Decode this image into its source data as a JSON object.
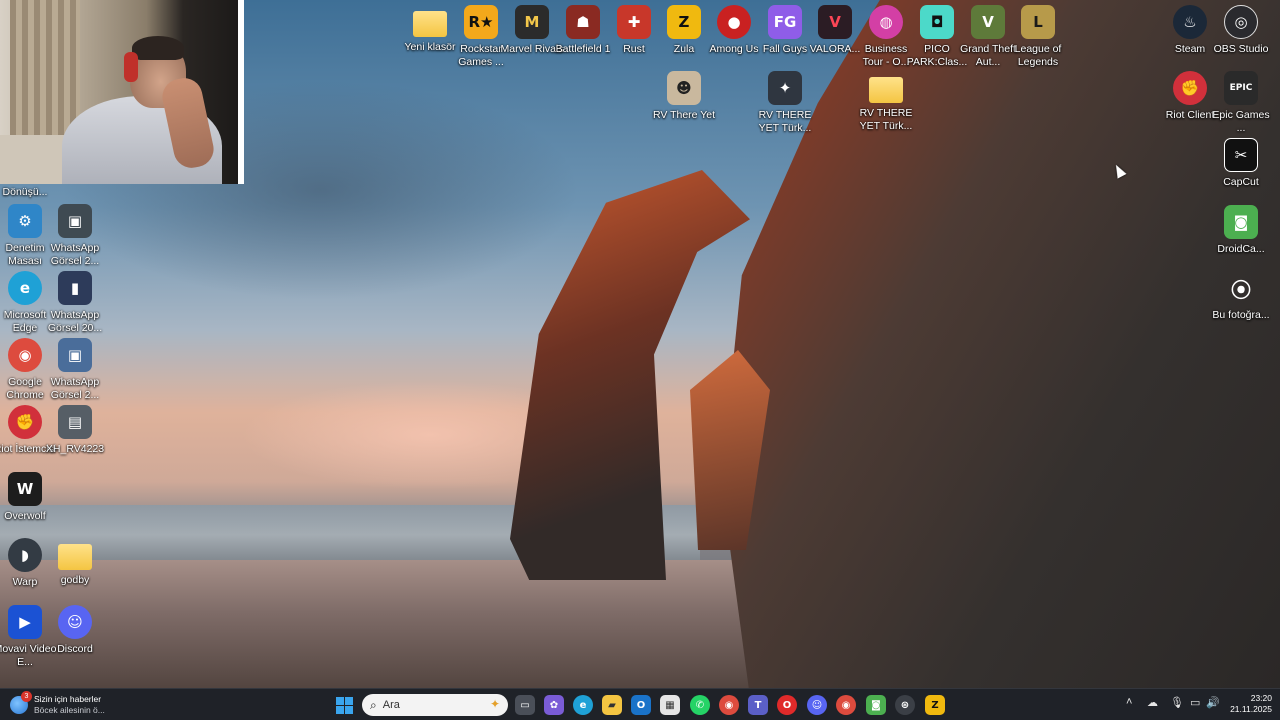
{
  "desktop": {
    "left_icons": [
      {
        "id": "recycle",
        "label": "Dönüşü...",
        "glyph": "",
        "color": "#3b6fb0"
      },
      {
        "id": "control-panel",
        "label": "Denetim Masası",
        "glyph": "⚙",
        "color": "#2f86c8"
      },
      {
        "id": "whatsapp-img-1",
        "label": "WhatsApp Görsel 2...",
        "glyph": "▣",
        "color": "#3f4a52"
      },
      {
        "id": "edge",
        "label": "Microsoft Edge",
        "glyph": "e",
        "color": "#1fa1d6"
      },
      {
        "id": "whatsapp-img-2",
        "label": "WhatsApp Görsel 20...",
        "glyph": "▮",
        "color": "#2d3b5a"
      },
      {
        "id": "chrome",
        "label": "Google Chrome",
        "glyph": "◉",
        "color": "#dd4b3e"
      },
      {
        "id": "whatsapp-img-3",
        "label": "WhatsApp Görsel 2...",
        "glyph": "▣",
        "color": "#4a6d9a"
      },
      {
        "id": "riot-istemcisi",
        "label": "Riot İstemcisi",
        "glyph": "✊",
        "color": "#d1303b"
      },
      {
        "id": "xh",
        "label": "XH_RV4223",
        "glyph": "▤",
        "color": "#565e66"
      },
      {
        "id": "overwolf",
        "label": "Overwolf",
        "glyph": "W",
        "color": "#1d1d1d"
      },
      {
        "id": "warp",
        "label": "Warp",
        "glyph": "◗",
        "color": "#333b44"
      },
      {
        "id": "godby",
        "label": "godby",
        "glyph": "",
        "color": "#f4c542"
      },
      {
        "id": "movavi",
        "label": "Movavi Video E...",
        "glyph": "▶",
        "color": "#1b52d4"
      },
      {
        "id": "discord",
        "label": "Discord",
        "glyph": "☺",
        "color": "#5865f2"
      }
    ],
    "top_icons": [
      {
        "id": "yeni-klasor",
        "label": "Yeni klasör",
        "glyph": "",
        "color": "#f4c542"
      },
      {
        "id": "rockstar",
        "label": "Rockstar Games ...",
        "glyph": "R★",
        "color": "#f3a81b"
      },
      {
        "id": "marvel-rivals",
        "label": "Marvel Rivals",
        "glyph": "M",
        "color": "#2b2b2b"
      },
      {
        "id": "battlefield",
        "label": "Battlefield 1",
        "glyph": "☗",
        "color": "#8a2a22"
      },
      {
        "id": "rust",
        "label": "Rust",
        "glyph": "✚",
        "color": "#c8372a"
      },
      {
        "id": "zula",
        "label": "Zula",
        "glyph": "Z",
        "color": "#f0b90f"
      },
      {
        "id": "among-us",
        "label": "Among Us",
        "glyph": "●",
        "color": "#c92121"
      },
      {
        "id": "fall-guys",
        "label": "Fall Guys",
        "glyph": "FG",
        "color": "#8f5de8"
      },
      {
        "id": "valorant",
        "label": "VALORA...",
        "glyph": "V",
        "color": "#2b1c24"
      },
      {
        "id": "business-tour",
        "label": "Business Tour - O...",
        "glyph": "◍",
        "color": "#d33fa5"
      },
      {
        "id": "pico-park",
        "label": "PICO PARK:Clas...",
        "glyph": "◘",
        "color": "#4cd9c9"
      },
      {
        "id": "gta",
        "label": "Grand Theft Aut...",
        "glyph": "V",
        "color": "#5e7a3a"
      },
      {
        "id": "league",
        "label": "League of Legends",
        "glyph": "L",
        "color": "#b79a4a"
      }
    ],
    "second_row_icons": [
      {
        "id": "rv-there-yet",
        "label": "RV There Yet",
        "glyph": "☻",
        "color": "#c9b89e"
      },
      {
        "id": "rv-there-yet-turk",
        "label": "RV THERE YET Türk...",
        "glyph": "✦",
        "color": "#2f3640"
      },
      {
        "id": "rv-there-yet-turk-folder",
        "label": "RV THERE YET Türk...",
        "glyph": "",
        "color": "#f4c542"
      }
    ],
    "right_icons": [
      {
        "id": "steam",
        "label": "Steam",
        "glyph": "♨",
        "color": "#1b2838"
      },
      {
        "id": "obs",
        "label": "OBS Studio",
        "glyph": "◎",
        "color": "#2a2a2e"
      },
      {
        "id": "riot-client",
        "label": "Riot Client",
        "glyph": "✊",
        "color": "#d1303b"
      },
      {
        "id": "epic",
        "label": "Epic Games ...",
        "glyph": "EPIC",
        "color": "#2a2a2a"
      },
      {
        "id": "capcut",
        "label": "CapCut",
        "glyph": "✂",
        "color": "#111111"
      },
      {
        "id": "droidcam",
        "label": "DroidCa...",
        "glyph": "◙",
        "color": "#4caf50"
      },
      {
        "id": "bu-fotograf",
        "label": "Bu fotoğra...",
        "glyph": "⦿",
        "color": "transparent"
      }
    ]
  },
  "taskbar": {
    "news_title": "Sizin için haberler",
    "news_subtitle": "Böcek ailesinin ö...",
    "news_badge": "3",
    "search_placeholder": "Ara",
    "apps": [
      {
        "id": "task-view",
        "glyph": "▭",
        "color": "#4a4f58"
      },
      {
        "id": "copilot",
        "glyph": "✿",
        "color": "#7a5cd6"
      },
      {
        "id": "edge",
        "glyph": "e",
        "color": "#1fa1d6"
      },
      {
        "id": "explorer",
        "glyph": "▰",
        "color": "#f4c542"
      },
      {
        "id": "outlook",
        "glyph": "O",
        "color": "#1a73c9"
      },
      {
        "id": "store",
        "glyph": "▦",
        "color": "#e6e6e6"
      },
      {
        "id": "whatsapp",
        "glyph": "✆",
        "color": "#25d366"
      },
      {
        "id": "chrome",
        "glyph": "◉",
        "color": "#dd4b3e"
      },
      {
        "id": "teams",
        "glyph": "T",
        "color": "#5b5fc7"
      },
      {
        "id": "opera",
        "glyph": "O",
        "color": "#e02a2a"
      },
      {
        "id": "discord",
        "glyph": "☺",
        "color": "#5865f2"
      },
      {
        "id": "chrome2",
        "glyph": "◉",
        "color": "#dd4b3e"
      },
      {
        "id": "android",
        "glyph": "◙",
        "color": "#4caf50"
      },
      {
        "id": "riot",
        "glyph": "⊛",
        "color": "#3b3f46"
      },
      {
        "id": "zula",
        "glyph": "Z",
        "color": "#f0b90f"
      }
    ],
    "time": "23:20",
    "date": "21.11.2025"
  }
}
